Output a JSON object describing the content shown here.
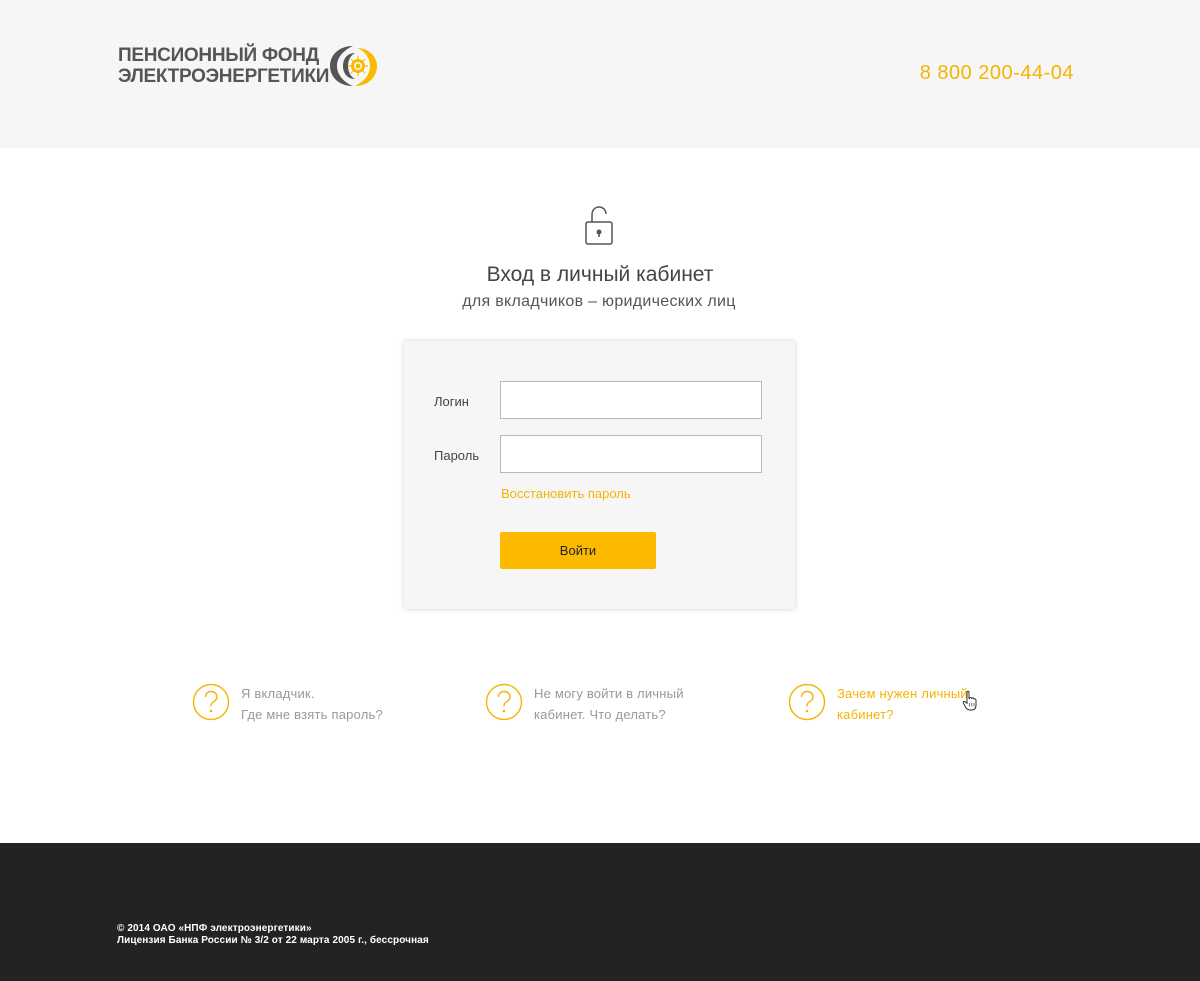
{
  "header": {
    "logo": {
      "line1": "ПЕНСИОННЫЙ ФОНД",
      "line2": "ЭЛЕКТРОЭНЕРГЕТИКИ"
    },
    "phone": "8 800 200-44-04"
  },
  "login": {
    "title": "Вход в личный кабинет",
    "subtitle": "для вкладчиков – юридических лиц",
    "login_label": "Логин",
    "login_value": "",
    "password_label": "Пароль",
    "password_value": "",
    "restore_link": "Восстановить пароль",
    "submit_label": "Войти"
  },
  "faq": [
    {
      "line1": "Я вкладчик.",
      "line2": "Где мне взять пароль?",
      "icon": "question-circle-icon"
    },
    {
      "line1": "Не могу войти в личный",
      "line2": "кабинет. Что делать?",
      "icon": "question-circle-icon"
    },
    {
      "line1": "Зачем нужен личный",
      "line2": "кабинет?",
      "icon": "question-circle-icon"
    }
  ],
  "footer": {
    "copyright": "© 2014 ОАО «НПФ электроэнергетики»",
    "license": "Лицензия Банка России № 3/2 от 22 марта 2005 г., бессрочная"
  },
  "colors": {
    "accent": "#f5b400",
    "button": "#fbb900",
    "header_bg": "#f6f6f6",
    "footer_bg": "#232323",
    "muted_text": "#999999"
  }
}
